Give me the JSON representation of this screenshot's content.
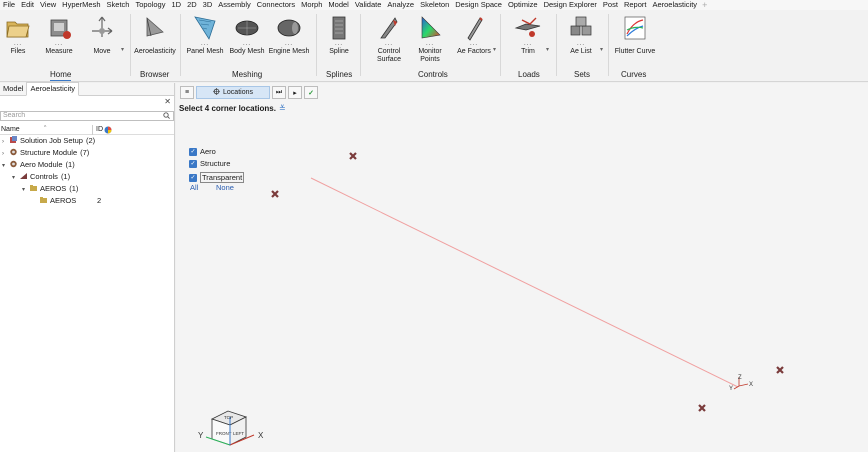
{
  "menubar": {
    "items": [
      "File",
      "Edit",
      "View",
      "HyperMesh",
      "Sketch",
      "Topology",
      "1D",
      "2D",
      "3D",
      "Assembly",
      "Connectors",
      "Morph",
      "Model",
      "Validate",
      "Analyze",
      "Skeleton",
      "Design Space",
      "Optimize",
      "Design Explorer",
      "Post",
      "Report",
      "Aeroelasticity"
    ],
    "active": "Aeroelasticity",
    "add_tab": "+"
  },
  "ribbon": {
    "tools": {
      "files": "Files",
      "measure": "Measure",
      "move": "Move",
      "aeroelasticity": "Aeroelasticity",
      "panel_mesh": "Panel Mesh",
      "body_mesh": "Body Mesh",
      "engine_mesh": "Engine Mesh",
      "spline": "Spline",
      "control_surface": "Control Surface",
      "monitor_points": "Monitor Points",
      "ae_factors": "Ae Factors",
      "trim": "Trim",
      "ae_list": "Ae List",
      "flutter_curve": "Flutter Curve"
    },
    "groups": {
      "home": "Home",
      "browser": "Browser",
      "meshing": "Meshing",
      "splines": "Splines",
      "controls": "Controls",
      "loads": "Loads",
      "sets": "Sets",
      "curves": "Curves"
    }
  },
  "left_panel": {
    "tabs": [
      "Model",
      "Aeroelasticity"
    ],
    "active_tab": "Aeroelasticity",
    "search_placeholder": "Search",
    "header": {
      "name": "Name",
      "id": "ID"
    },
    "tree": [
      {
        "label": "Solution Job Setup",
        "count": "(2)",
        "id": "",
        "level": 0,
        "expanded": false
      },
      {
        "label": "Structure Module",
        "count": "(7)",
        "id": "",
        "level": 0,
        "expanded": false
      },
      {
        "label": "Aero Module",
        "count": "(1)",
        "id": "",
        "level": 0,
        "expanded": true
      },
      {
        "label": "Controls",
        "count": "(1)",
        "id": "",
        "level": 1,
        "expanded": true
      },
      {
        "label": "AEROS",
        "count": "(1)",
        "id": "",
        "level": 2,
        "expanded": true
      },
      {
        "label": "AEROS",
        "count": "",
        "id": "2",
        "level": 3,
        "expanded": false
      }
    ]
  },
  "viewport": {
    "guide_bar": {
      "menu": "≡",
      "locations_label": "Locations",
      "skip": "⏭",
      "next": "▸",
      "confirm": "✓"
    },
    "prompt": "Select 4 corner locations.",
    "checkboxes": [
      {
        "label": "Aero",
        "checked": true
      },
      {
        "label": "Structure",
        "checked": true
      },
      {
        "label": "Transparent",
        "checked": true
      }
    ],
    "link_all": "All",
    "link_none": "None",
    "triad": {
      "x": "X",
      "y": "Y",
      "z": "Z"
    },
    "viewcube": {
      "front": "FRONT",
      "left": "LEFT",
      "top": "TOP",
      "x": "X",
      "y": "Y"
    }
  },
  "colors": {
    "accent": "#3a78c6",
    "marker": "#7a3b3b",
    "rubber_band": "#f0a0a0"
  }
}
